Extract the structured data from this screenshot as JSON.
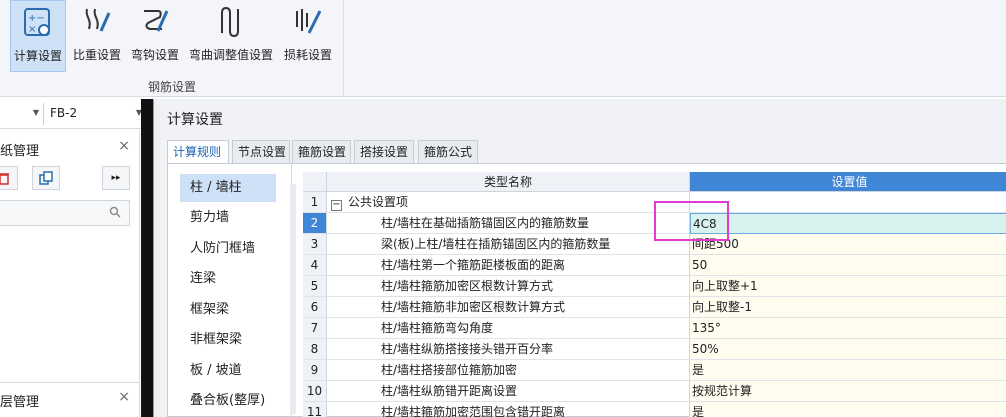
{
  "ribbon": {
    "buttons": [
      {
        "label": "计算设置",
        "icon": "calc-settings-icon",
        "active": true
      },
      {
        "label": "比重设置",
        "icon": "density-settings-icon"
      },
      {
        "label": "弯钩设置",
        "icon": "hook-settings-icon"
      },
      {
        "label": "弯曲调整值设置",
        "icon": "bend-adjust-icon"
      },
      {
        "label": "损耗设置",
        "icon": "loss-settings-icon"
      }
    ],
    "group_title": "钢筋设置"
  },
  "left": {
    "combo_value": "FB-2",
    "panel1_title": "纸管理",
    "panel2_title": "层管理",
    "close": "×"
  },
  "dialog": {
    "title": "计算设置",
    "tabs": [
      "计算规则",
      "节点设置",
      "箍筋设置",
      "搭接设置",
      "箍筋公式"
    ],
    "categories": [
      "柱 / 墙柱",
      "剪力墙",
      "人防门框墙",
      "连梁",
      "框架梁",
      "非框架梁",
      "板 / 坡道",
      "叠合板(整厚)"
    ],
    "grid": {
      "headers": {
        "num": "",
        "name": "类型名称",
        "value": "设置值"
      },
      "group": {
        "num": "1",
        "label": "公共设置项",
        "toggle": "−"
      },
      "rows": [
        {
          "num": "2",
          "name": "柱/墙柱在基础插筋锚固区内的箍筋数量",
          "value": "4C8"
        },
        {
          "num": "3",
          "name": "梁(板)上柱/墙柱在插筋锚固区内的箍筋数量",
          "value": "间距500"
        },
        {
          "num": "4",
          "name": "柱/墙柱第一个箍筋距楼板面的距离",
          "value": "50"
        },
        {
          "num": "5",
          "name": "柱/墙柱箍筋加密区根数计算方式",
          "value": "向上取整+1"
        },
        {
          "num": "6",
          "name": "柱/墙柱箍筋非加密区根数计算方式",
          "value": "向上取整-1"
        },
        {
          "num": "7",
          "name": "柱/墙柱箍筋弯勾角度",
          "value": "135°"
        },
        {
          "num": "8",
          "name": "柱/墙柱纵筋搭接接头错开百分率",
          "value": "50%"
        },
        {
          "num": "9",
          "name": "柱/墙柱搭接部位箍筋加密",
          "value": "是"
        },
        {
          "num": "10",
          "name": "柱/墙柱纵筋错开距离设置",
          "value": "按规范计算"
        },
        {
          "num": "11",
          "name": "柱/墙柱箍筋加密范围包含错开距离",
          "value": "是"
        }
      ]
    }
  },
  "colors": {
    "accent": "#3f86d6",
    "highlight": "#e23bd2"
  }
}
